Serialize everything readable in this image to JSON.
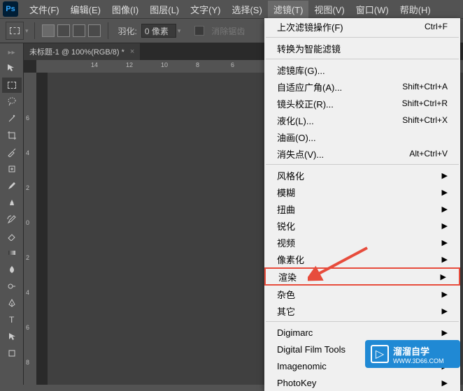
{
  "menubar": {
    "items": [
      "文件(F)",
      "编辑(E)",
      "图像(I)",
      "图层(L)",
      "文字(Y)",
      "选择(S)",
      "滤镜(T)",
      "视图(V)",
      "窗口(W)",
      "帮助(H)"
    ],
    "active_index": 6
  },
  "options_bar": {
    "feather_label": "羽化:",
    "feather_value": "0 像素",
    "antialias_label": "消除锯齿"
  },
  "document": {
    "tab_title": "未标题-1 @ 100%(RGB/8) *",
    "ruler_top_marks": [
      {
        "pos": 28,
        "label": ""
      },
      {
        "pos": 78,
        "label": "14"
      },
      {
        "pos": 128,
        "label": "12"
      },
      {
        "pos": 178,
        "label": "10"
      },
      {
        "pos": 228,
        "label": "8"
      },
      {
        "pos": 278,
        "label": "6"
      }
    ],
    "ruler_left_marks": [
      {
        "pos": 10,
        "label": ""
      },
      {
        "pos": 60,
        "label": "6"
      },
      {
        "pos": 110,
        "label": "4"
      },
      {
        "pos": 160,
        "label": "2"
      },
      {
        "pos": 210,
        "label": "0"
      },
      {
        "pos": 260,
        "label": "2"
      },
      {
        "pos": 310,
        "label": "4"
      },
      {
        "pos": 360,
        "label": "6"
      },
      {
        "pos": 410,
        "label": "8"
      }
    ]
  },
  "filter_menu": {
    "sections": [
      [
        {
          "label": "上次滤镜操作(F)",
          "shortcut": "Ctrl+F",
          "submenu": false
        }
      ],
      [
        {
          "label": "转换为智能滤镜",
          "shortcut": "",
          "submenu": false
        }
      ],
      [
        {
          "label": "滤镜库(G)...",
          "shortcut": "",
          "submenu": false
        },
        {
          "label": "自适应广角(A)...",
          "shortcut": "Shift+Ctrl+A",
          "submenu": false
        },
        {
          "label": "镜头校正(R)...",
          "shortcut": "Shift+Ctrl+R",
          "submenu": false
        },
        {
          "label": "液化(L)...",
          "shortcut": "Shift+Ctrl+X",
          "submenu": false
        },
        {
          "label": "油画(O)...",
          "shortcut": "",
          "submenu": false
        },
        {
          "label": "消失点(V)...",
          "shortcut": "Alt+Ctrl+V",
          "submenu": false
        }
      ],
      [
        {
          "label": "风格化",
          "shortcut": "",
          "submenu": true
        },
        {
          "label": "模糊",
          "shortcut": "",
          "submenu": true
        },
        {
          "label": "扭曲",
          "shortcut": "",
          "submenu": true
        },
        {
          "label": "锐化",
          "shortcut": "",
          "submenu": true
        },
        {
          "label": "视频",
          "shortcut": "",
          "submenu": true
        },
        {
          "label": "像素化",
          "shortcut": "",
          "submenu": true
        },
        {
          "label": "渲染",
          "shortcut": "",
          "submenu": true,
          "highlighted": true
        },
        {
          "label": "杂色",
          "shortcut": "",
          "submenu": true
        },
        {
          "label": "其它",
          "shortcut": "",
          "submenu": true
        }
      ],
      [
        {
          "label": "Digimarc",
          "shortcut": "",
          "submenu": true
        },
        {
          "label": "Digital Film Tools",
          "shortcut": "",
          "submenu": true
        },
        {
          "label": "Imagenomic",
          "shortcut": "",
          "submenu": true
        },
        {
          "label": "PhotoKey",
          "shortcut": "",
          "submenu": true
        }
      ]
    ]
  },
  "watermark": {
    "line1": "溜溜自学",
    "line2": "WWW.3D66.COM"
  }
}
